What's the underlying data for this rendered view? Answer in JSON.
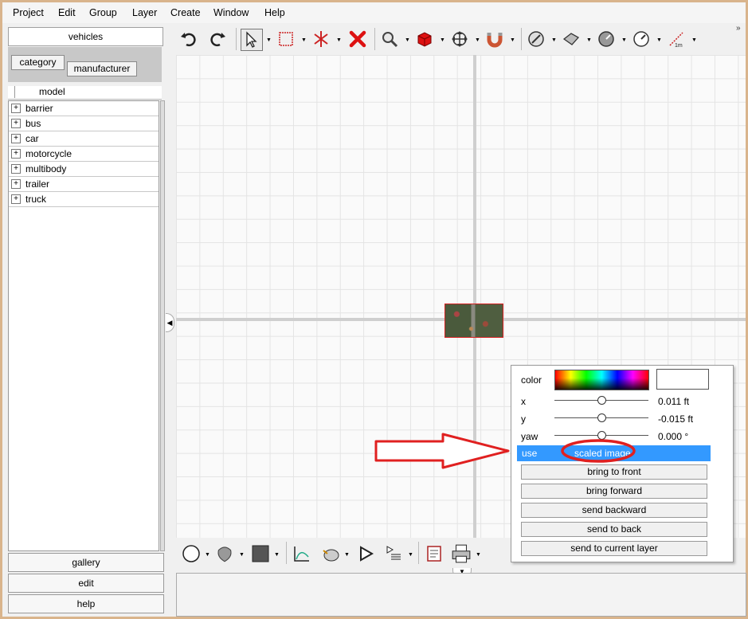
{
  "menu": [
    "Project",
    "Edit",
    "Group",
    "Layer",
    "Create",
    "Window",
    "Help"
  ],
  "left_panel": {
    "header_button": "vehicles",
    "tabs": [
      "category",
      "manufacturer"
    ],
    "column_header": "model",
    "tree_items": [
      "barrier",
      "bus",
      "car",
      "motorcycle",
      "multibody",
      "trailer",
      "truck"
    ],
    "bottom_buttons": [
      "gallery",
      "edit",
      "help"
    ]
  },
  "properties": {
    "color_label": "color",
    "x_label": "x",
    "x_value": "0.011 ft",
    "y_label": "y",
    "y_value": "-0.015 ft",
    "yaw_label": "yaw",
    "yaw_value": "0.000 °",
    "use_label": "use",
    "use_value": "scaled image",
    "buttons": [
      "bring to front",
      "bring forward",
      "send backward",
      "send to back",
      "send to current layer"
    ]
  },
  "toolbar_icons": [
    "undo-icon",
    "redo-icon",
    "select-arrow-icon",
    "rect-select-icon",
    "split-icon",
    "delete-x-icon",
    "zoom-icon",
    "cube-icon",
    "move-icon",
    "magnet-icon",
    "curve-icon",
    "paint-icon",
    "gauge-icon",
    "speed-icon",
    "measure-icon"
  ],
  "toolbar_measure_text": "1m",
  "colors": {
    "accent": "#3399ff",
    "annotation_red": "#e02020",
    "frame": "#d9b48c"
  }
}
